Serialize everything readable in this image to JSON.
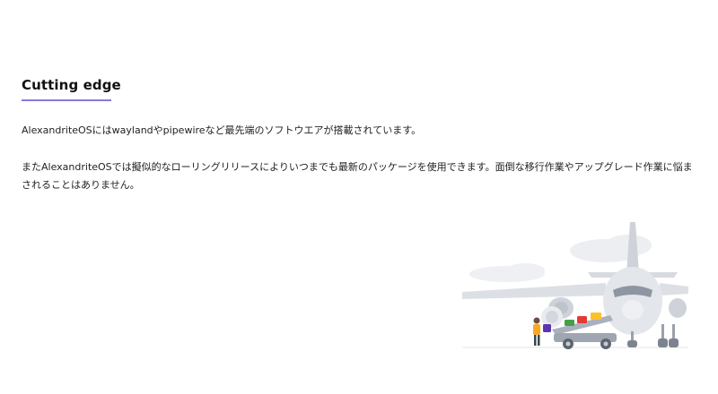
{
  "section": {
    "heading": "Cutting edge",
    "paragraphs": [
      "AlexandriteOSにはwaylandやpipewireなど最先端のソフトウエアが搭載されています。",
      "またAlexandriteOSでは擬似的なローリングリリースによりいつまでも最新のパッケージを使用できます。面倒な移行作業やアップグレード作業に悩まされることはありません。"
    ]
  },
  "illustration": {
    "icon": "airplane-baggage-loading-illustration",
    "colors": {
      "plane": "#d9dde3",
      "cloud": "#eceef1",
      "cart": "#9fa6b2",
      "bag_red": "#e53935",
      "bag_green": "#43a047",
      "bag_yellow": "#fbc02d",
      "bag_purple": "#5e35b1",
      "worker_vest": "#f9a825"
    }
  },
  "theme": {
    "accent": "#8b79d9"
  }
}
